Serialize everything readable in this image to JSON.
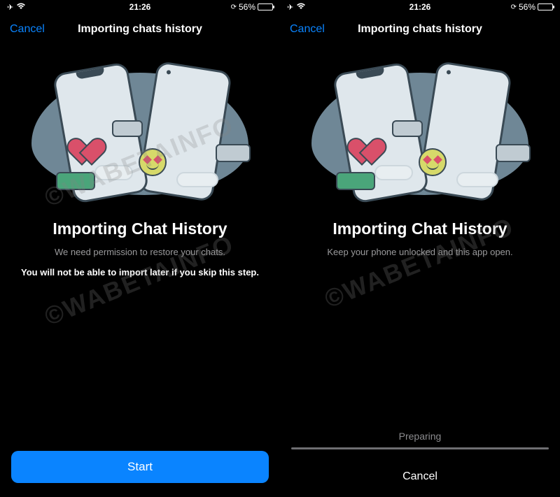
{
  "statusBar": {
    "time": "21:26",
    "battery_pct": "56%",
    "battery_fill_pct": 56
  },
  "watermark": "©WABETAINFO",
  "left": {
    "nav": {
      "cancel": "Cancel",
      "title": "Importing chats history"
    },
    "heading": "Importing Chat History",
    "subtitle": "We need permission to restore your chats.",
    "warning": "You will not be able to import later if you skip this step.",
    "start_button": "Start"
  },
  "right": {
    "nav": {
      "cancel": "Cancel",
      "title": "Importing chats history"
    },
    "heading": "Importing Chat History",
    "subtitle": "Keep your phone unlocked and this app open.",
    "preparing_label": "Preparing",
    "cancel_button": "Cancel"
  }
}
